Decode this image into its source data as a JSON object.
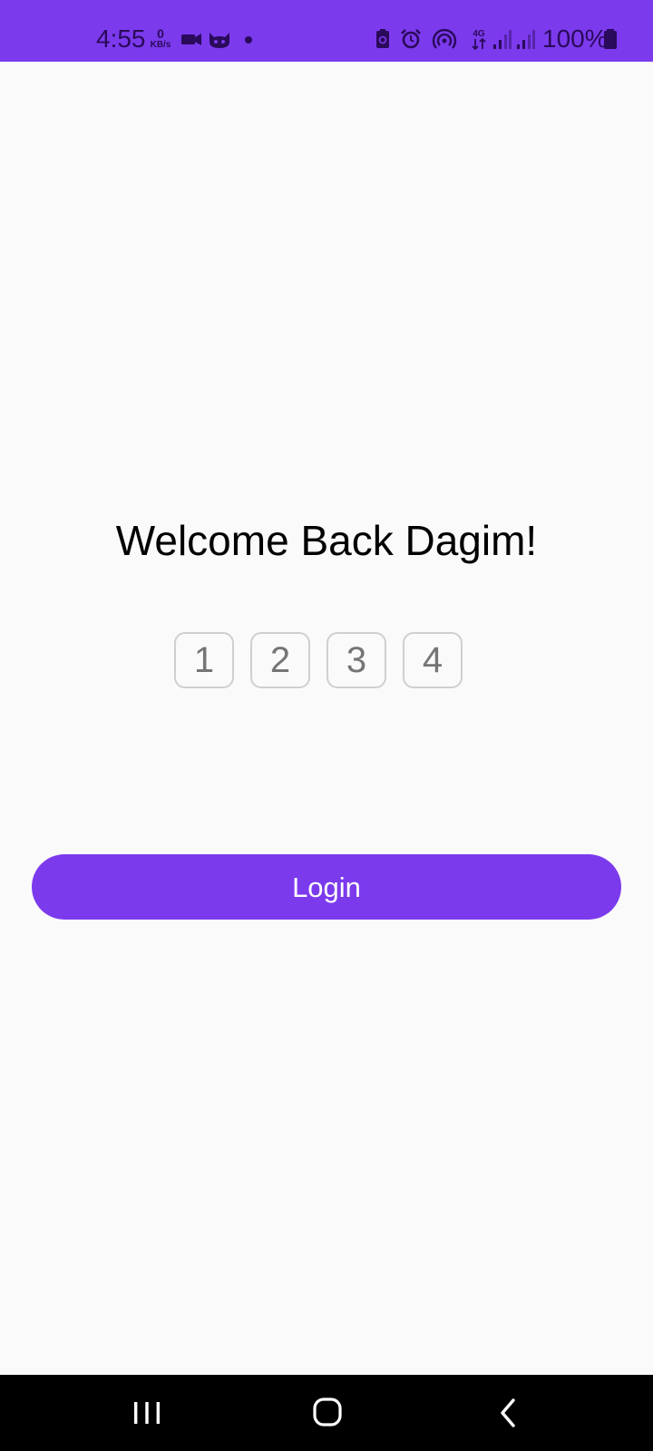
{
  "status_bar": {
    "time": "4:55",
    "net_speed_value": "0",
    "net_speed_unit": "KB/s",
    "network_type": "4G",
    "battery_percent": "100%",
    "background_color": "#7c3aed",
    "icons": [
      "video-camera-icon",
      "cat-app-icon",
      "notification-dot-icon",
      "battery-saver-icon",
      "alarm-icon",
      "hotspot-icon",
      "4g-data-icon",
      "signal-strength-icon",
      "signal-strength-icon-2",
      "battery-icon"
    ]
  },
  "login": {
    "title": "Welcome Back Dagim!",
    "pin_placeholders": [
      "1",
      "2",
      "3",
      "4"
    ],
    "button_label": "Login",
    "accent_color": "#7c3aed"
  },
  "nav_bar": {
    "icons": [
      "recent-apps-icon",
      "home-icon",
      "back-icon"
    ]
  }
}
